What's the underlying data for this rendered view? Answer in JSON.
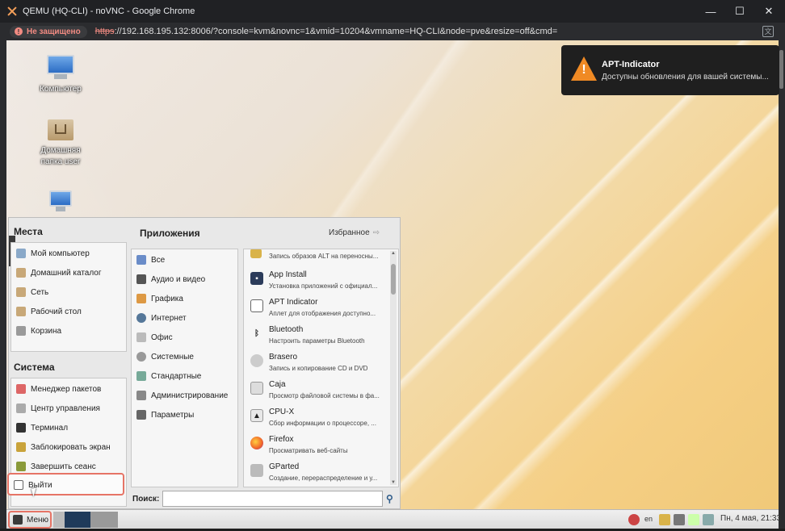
{
  "browser": {
    "window_title": "QEMU (HQ-CLI) - noVNC - Google Chrome",
    "security_badge": "Не защищено",
    "url_scheme": "https",
    "url_rest": "://192.168.195.132:8006/?console=kvm&novnc=1&vmid=10204&vmname=HQ-CLI&node=pve&resize=off&cmd=",
    "minimize": "—",
    "maximize": "☐",
    "close": "✕"
  },
  "desktop": {
    "icons": [
      {
        "label": "Компьютер"
      },
      {
        "label": "Домашняя папка user"
      }
    ]
  },
  "notification": {
    "title": "APT-Indicator",
    "message": "Доступны обновления для вашей системы..."
  },
  "menu": {
    "places": {
      "title": "Места",
      "items": [
        {
          "label": "Мой компьютер"
        },
        {
          "label": "Домашний каталог"
        },
        {
          "label": "Сеть"
        },
        {
          "label": "Рабочий стол"
        },
        {
          "label": "Корзина"
        }
      ]
    },
    "system": {
      "title": "Система",
      "items": [
        {
          "label": "Менеджер пакетов"
        },
        {
          "label": "Центр управления"
        },
        {
          "label": "Терминал"
        },
        {
          "label": "Заблокировать экран"
        },
        {
          "label": "Завершить сеанс"
        },
        {
          "label": "Выйти"
        }
      ]
    },
    "apps": {
      "title": "Приложения",
      "favorites_label": "Избранное",
      "categories": [
        {
          "label": "Все"
        },
        {
          "label": "Аудио и видео"
        },
        {
          "label": "Графика"
        },
        {
          "label": "Интернет"
        },
        {
          "label": "Офис"
        },
        {
          "label": "Системные"
        },
        {
          "label": "Стандартные"
        },
        {
          "label": "Администрирование"
        },
        {
          "label": "Параметры"
        }
      ],
      "top_partial": "Запись образов ALT на переносны...",
      "list": [
        {
          "name": "App Install",
          "desc": "Установка приложений с официал..."
        },
        {
          "name": "APT Indicator",
          "desc": "Аплет для отображения доступно..."
        },
        {
          "name": "Bluetooth",
          "desc": "Настроить параметры Bluetooth"
        },
        {
          "name": "Brasero",
          "desc": "Запись и копирование CD и DVD"
        },
        {
          "name": "Caja",
          "desc": "Просмотр файловой системы в фа..."
        },
        {
          "name": "CPU-X",
          "desc": "Сбор информации о процессоре, ..."
        },
        {
          "name": "Firefox",
          "desc": "Просматривать веб-сайты"
        },
        {
          "name": "GParted",
          "desc": "Создание, перераспределение и у..."
        }
      ],
      "search_label": "Поиск:",
      "search_value": ""
    }
  },
  "taskbar": {
    "menu_label": "Меню",
    "lang": "en",
    "clock": "Пн, 4 мая, 21:33"
  },
  "colors": {
    "highlight": "#e67466",
    "warning": "#f08a24"
  }
}
